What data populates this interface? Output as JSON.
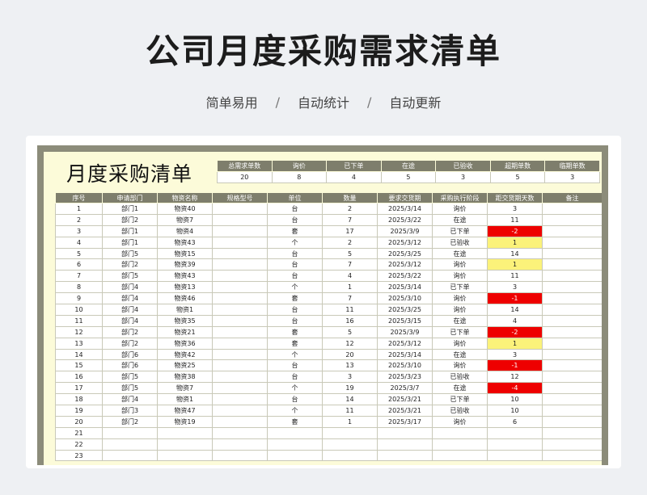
{
  "header": {
    "title": "公司月度采购需求清单",
    "tags": [
      "简单易用",
      "自动统计",
      "自动更新"
    ],
    "separator": "/"
  },
  "sheet": {
    "title": "月度采购清单",
    "summary": {
      "labels": [
        "总需求单数",
        "询价",
        "已下单",
        "在途",
        "已验收",
        "超期单数",
        "临期单数"
      ],
      "values": [
        "20",
        "8",
        "4",
        "5",
        "3",
        "5",
        "3"
      ]
    },
    "columns": [
      "序号",
      "申请部门",
      "物资名称",
      "规格型号",
      "单位",
      "数量",
      "要求交货期",
      "采购执行阶段",
      "距交货期天数",
      "备注"
    ],
    "rows": [
      {
        "no": "1",
        "dept": "部门1",
        "item": "物资40",
        "spec": "",
        "unit": "台",
        "qty": "2",
        "date": "2025/3/14",
        "stage": "询价",
        "days": "3",
        "flag": "",
        "note": ""
      },
      {
        "no": "2",
        "dept": "部门2",
        "item": "物资7",
        "spec": "",
        "unit": "台",
        "qty": "7",
        "date": "2025/3/22",
        "stage": "在途",
        "days": "11",
        "flag": "",
        "note": ""
      },
      {
        "no": "3",
        "dept": "部门1",
        "item": "物资4",
        "spec": "",
        "unit": "套",
        "qty": "17",
        "date": "2025/3/9",
        "stage": "已下单",
        "days": "-2",
        "flag": "red",
        "note": ""
      },
      {
        "no": "4",
        "dept": "部门1",
        "item": "物资43",
        "spec": "",
        "unit": "个",
        "qty": "2",
        "date": "2025/3/12",
        "stage": "已验收",
        "days": "1",
        "flag": "yellow",
        "note": ""
      },
      {
        "no": "5",
        "dept": "部门5",
        "item": "物资15",
        "spec": "",
        "unit": "台",
        "qty": "5",
        "date": "2025/3/25",
        "stage": "在途",
        "days": "14",
        "flag": "",
        "note": ""
      },
      {
        "no": "6",
        "dept": "部门2",
        "item": "物资39",
        "spec": "",
        "unit": "台",
        "qty": "7",
        "date": "2025/3/12",
        "stage": "询价",
        "days": "1",
        "flag": "yellow",
        "note": ""
      },
      {
        "no": "7",
        "dept": "部门5",
        "item": "物资43",
        "spec": "",
        "unit": "台",
        "qty": "4",
        "date": "2025/3/22",
        "stage": "询价",
        "days": "11",
        "flag": "",
        "note": ""
      },
      {
        "no": "8",
        "dept": "部门4",
        "item": "物资13",
        "spec": "",
        "unit": "个",
        "qty": "1",
        "date": "2025/3/14",
        "stage": "已下单",
        "days": "3",
        "flag": "",
        "note": ""
      },
      {
        "no": "9",
        "dept": "部门4",
        "item": "物资46",
        "spec": "",
        "unit": "套",
        "qty": "7",
        "date": "2025/3/10",
        "stage": "询价",
        "days": "-1",
        "flag": "red",
        "note": ""
      },
      {
        "no": "10",
        "dept": "部门4",
        "item": "物资1",
        "spec": "",
        "unit": "台",
        "qty": "11",
        "date": "2025/3/25",
        "stage": "询价",
        "days": "14",
        "flag": "",
        "note": ""
      },
      {
        "no": "11",
        "dept": "部门4",
        "item": "物资35",
        "spec": "",
        "unit": "台",
        "qty": "16",
        "date": "2025/3/15",
        "stage": "在途",
        "days": "4",
        "flag": "",
        "note": ""
      },
      {
        "no": "12",
        "dept": "部门2",
        "item": "物资21",
        "spec": "",
        "unit": "套",
        "qty": "5",
        "date": "2025/3/9",
        "stage": "已下单",
        "days": "-2",
        "flag": "red",
        "note": ""
      },
      {
        "no": "13",
        "dept": "部门2",
        "item": "物资36",
        "spec": "",
        "unit": "套",
        "qty": "12",
        "date": "2025/3/12",
        "stage": "询价",
        "days": "1",
        "flag": "yellow",
        "note": ""
      },
      {
        "no": "14",
        "dept": "部门6",
        "item": "物资42",
        "spec": "",
        "unit": "个",
        "qty": "20",
        "date": "2025/3/14",
        "stage": "在途",
        "days": "3",
        "flag": "",
        "note": ""
      },
      {
        "no": "15",
        "dept": "部门6",
        "item": "物资25",
        "spec": "",
        "unit": "台",
        "qty": "13",
        "date": "2025/3/10",
        "stage": "询价",
        "days": "-1",
        "flag": "red",
        "note": ""
      },
      {
        "no": "16",
        "dept": "部门5",
        "item": "物资38",
        "spec": "",
        "unit": "台",
        "qty": "3",
        "date": "2025/3/23",
        "stage": "已验收",
        "days": "12",
        "flag": "",
        "note": ""
      },
      {
        "no": "17",
        "dept": "部门5",
        "item": "物资7",
        "spec": "",
        "unit": "个",
        "qty": "19",
        "date": "2025/3/7",
        "stage": "在途",
        "days": "-4",
        "flag": "red",
        "note": ""
      },
      {
        "no": "18",
        "dept": "部门4",
        "item": "物资1",
        "spec": "",
        "unit": "台",
        "qty": "14",
        "date": "2025/3/21",
        "stage": "已下单",
        "days": "10",
        "flag": "",
        "note": ""
      },
      {
        "no": "19",
        "dept": "部门3",
        "item": "物资47",
        "spec": "",
        "unit": "个",
        "qty": "11",
        "date": "2025/3/21",
        "stage": "已验收",
        "days": "10",
        "flag": "",
        "note": ""
      },
      {
        "no": "20",
        "dept": "部门2",
        "item": "物资19",
        "spec": "",
        "unit": "套",
        "qty": "1",
        "date": "2025/3/17",
        "stage": "询价",
        "days": "6",
        "flag": "",
        "note": ""
      },
      {
        "no": "21",
        "dept": "",
        "item": "",
        "spec": "",
        "unit": "",
        "qty": "",
        "date": "",
        "stage": "",
        "days": "",
        "flag": "",
        "note": ""
      },
      {
        "no": "22",
        "dept": "",
        "item": "",
        "spec": "",
        "unit": "",
        "qty": "",
        "date": "",
        "stage": "",
        "days": "",
        "flag": "",
        "note": ""
      },
      {
        "no": "23",
        "dept": "",
        "item": "",
        "spec": "",
        "unit": "",
        "qty": "",
        "date": "",
        "stage": "",
        "days": "",
        "flag": "",
        "note": ""
      }
    ]
  },
  "colors": {
    "header_bg": "#7e7e6c",
    "sheet_bg": "#fcfbd9",
    "overdue": "#ee0000",
    "near_due": "#fbf27a"
  }
}
